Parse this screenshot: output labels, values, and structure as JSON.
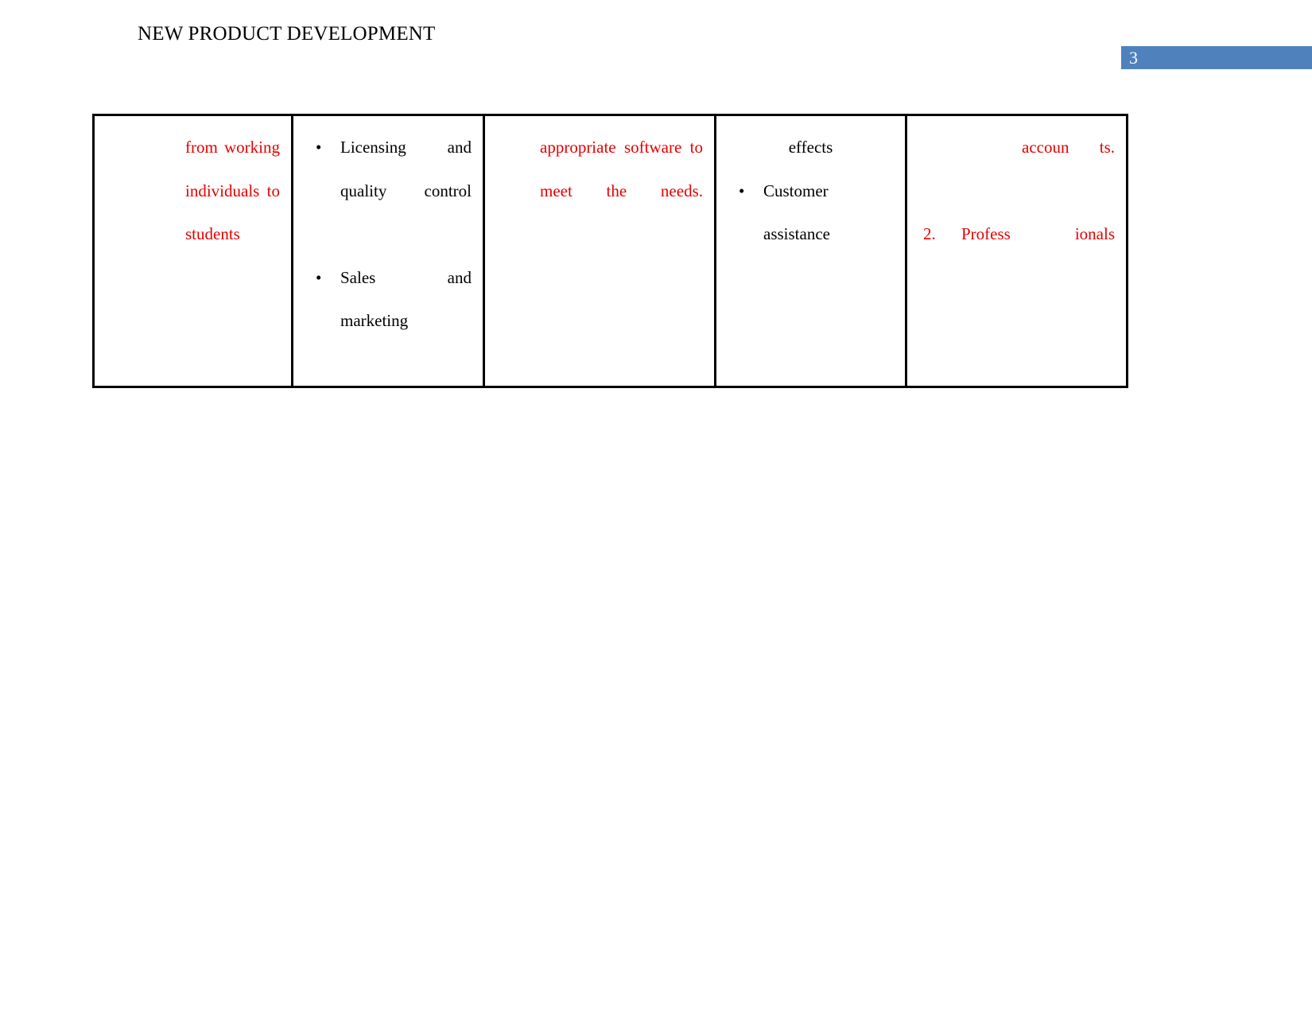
{
  "slide": {
    "title": "NEW PRODUCT DEVELOPMENT",
    "page_number": "3",
    "badge_color": "#4f81bd",
    "accent_text_color": "#e40000"
  },
  "table": {
    "columns": [
      {
        "id": "column-1",
        "text_color": "red",
        "blocks": [
          {
            "kind": "paragraph",
            "text": "from working individuals to students"
          }
        ]
      },
      {
        "id": "column-2",
        "text_color": "black",
        "blocks": [
          {
            "kind": "bullet-list",
            "bullet_glyph": "•",
            "items": [
              "Licensing and quality control",
              "Sales and marketing"
            ]
          }
        ]
      },
      {
        "id": "column-3",
        "text_color": "red",
        "blocks": [
          {
            "kind": "paragraph",
            "text": "appropriate software to meet the needs."
          }
        ]
      },
      {
        "id": "column-4",
        "text_color": "black",
        "blocks": [
          {
            "kind": "lead-line",
            "text": "effects"
          },
          {
            "kind": "bullet-list",
            "bullet_glyph": "•",
            "items": [
              "Customer assistance"
            ]
          }
        ]
      },
      {
        "id": "column-5",
        "text_color": "red",
        "blocks": [
          {
            "kind": "paragraph",
            "text": "accoun ts."
          },
          {
            "kind": "numbered-list",
            "items": [
              {
                "marker": "2.",
                "text": "Profess ionals"
              }
            ]
          }
        ]
      }
    ]
  }
}
